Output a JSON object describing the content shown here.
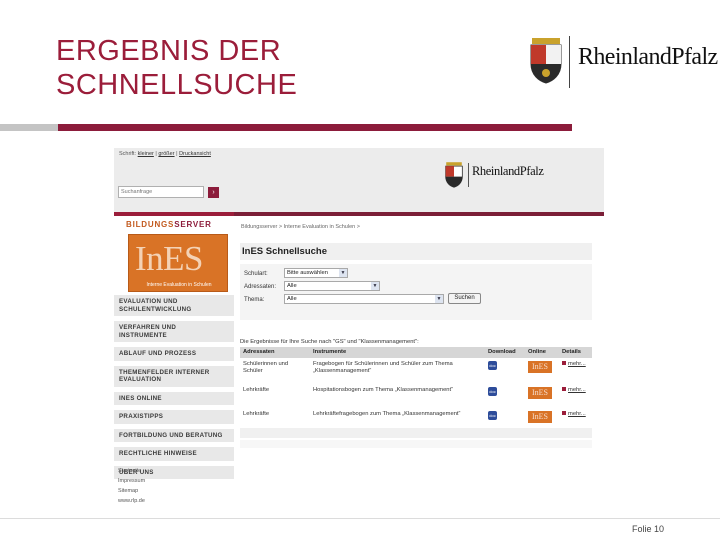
{
  "slide": {
    "title_line1": "ERGEBNIS DER",
    "title_line2": "SCHNELLSUCHE",
    "logo_text": "RheinlandPfalz",
    "footer": "Folie 10",
    "accent_color": "#8c1c3b"
  },
  "screenshot": {
    "fontsize_prefix": "Schrift: ",
    "fontsize_smaller": "kleiner",
    "fontsize_sep": " | ",
    "fontsize_larger": "größer",
    "fontsize_sep2": " | ",
    "print_view": "Druckansicht",
    "search_placeholder": "Suchanfrage",
    "search_button_icon": "arrow-right-icon",
    "logo_text": "RheinlandPfalz",
    "portal_name_part1": "BILDUNGS",
    "portal_name_part2": "SERVER",
    "ines_logo": "InES",
    "ines_tagline": "Interne Evaluation in Schulen",
    "nav_items": [
      "EVALUATION UND\nSCHULENTWICKLUNG",
      "VERFAHREN UND\nINSTRUMENTE",
      "ABLAUF UND PROZESS",
      "THEMENFELDER INTERNER\nEVALUATION",
      "INES ONLINE",
      "PRAXISTIPPS",
      "FORTBILDUNG UND BERATUNG",
      "RECHTLICHE HINWEISE",
      "ÜBER UNS"
    ],
    "footer_links": [
      "Startseite",
      "Impressum",
      "Sitemap",
      "www.rlp.de"
    ],
    "breadcrumb": "Bildungsserver > Interne Evaluation in Schulen >",
    "page_title": "InES Schnellsuche",
    "form": {
      "schulart_label": "Schulart:",
      "schulart_value": "Bitte auswählen",
      "adressaten_label": "Adressaten:",
      "adressaten_value": "Alle",
      "thema_label": "Thema:",
      "thema_value": "Alle",
      "search_button": "Suchen"
    },
    "results_caption": "Die Ergebnisse für Ihre Suche nach \"GS\" und \"Klassenmanagement\":",
    "table": {
      "headers": [
        "Adressaten",
        "Instrumente",
        "Download",
        "Online",
        "Details"
      ],
      "rows": [
        {
          "adressaten": "Schülerinnen und Schüler",
          "instrument": "Fragebogen für Schülerinnen und Schüler zum Thema „Klassenmanagement“",
          "online_badge": "InES",
          "details": "mehr..."
        },
        {
          "adressaten": "Lehrkräfte",
          "instrument": "Hospitationsbogen zum Thema „Klassenmanagement“",
          "online_badge": "InES",
          "details": "mehr..."
        },
        {
          "adressaten": "Lehrkräfte",
          "instrument": "Lehrkräftefragebogen zum Thema „Klassenmanagement“",
          "online_badge": "InES",
          "details": "mehr..."
        }
      ]
    }
  }
}
